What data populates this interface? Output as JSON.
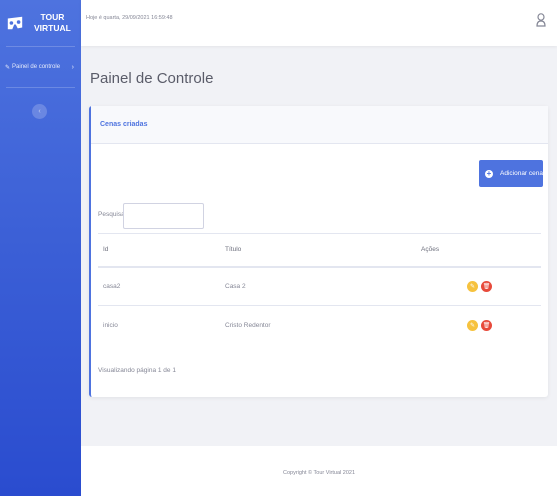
{
  "sidebar": {
    "brand_line1": "TOUR",
    "brand_line2": "VIRTUAL",
    "nav_item_label": "Painel de controle",
    "toggle_icon": "chevron-left-icon"
  },
  "topbar": {
    "datetime": "Hoje é quarta, 29/09/2021 16:59:48",
    "user_icon": "user-icon"
  },
  "page": {
    "title": "Painel de Controle"
  },
  "card": {
    "header": "Cenas criadas",
    "add_button": "Adicionar cena",
    "search_label": "Pesquisar",
    "search_value": "",
    "table": {
      "headers": [
        "Id",
        "Título",
        "Ações"
      ],
      "rows": [
        {
          "id": "casa2",
          "title": "Casa 2"
        },
        {
          "id": "inicio",
          "title": "Cristo Redentor"
        }
      ]
    },
    "pagination": "Visualizando página 1 de 1"
  },
  "footer": {
    "copyright": "Copyright © Tour Virtual 2021"
  },
  "colors": {
    "primary": "#4e73df",
    "warning": "#f6c23e",
    "danger": "#e74a3b"
  }
}
